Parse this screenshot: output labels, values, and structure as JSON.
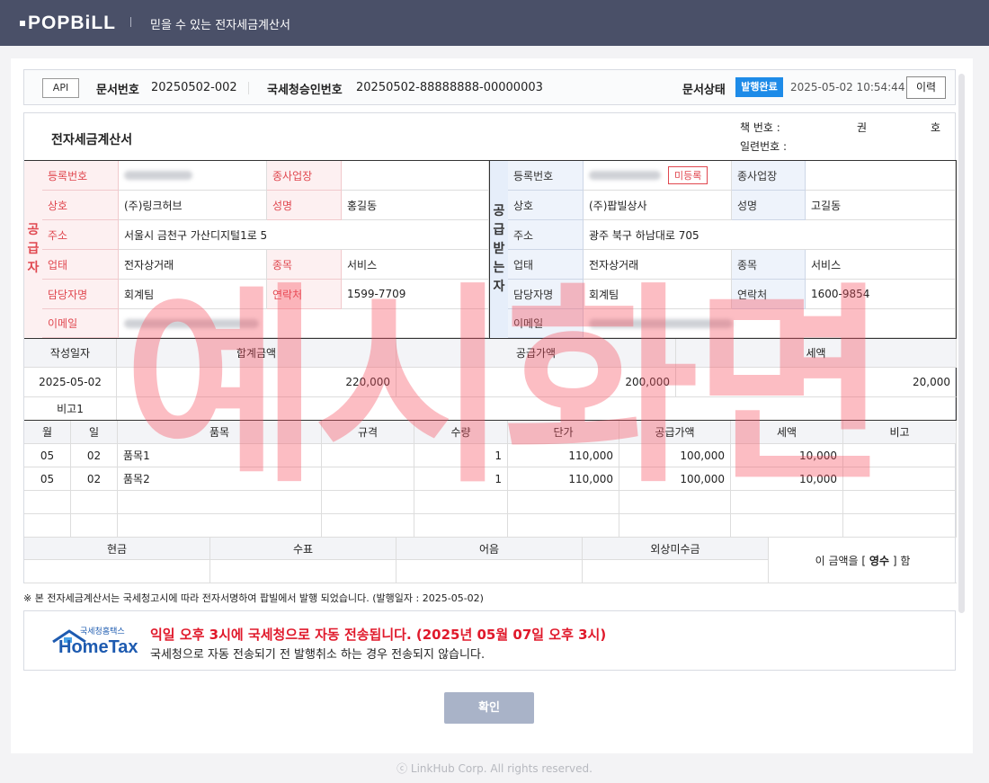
{
  "header": {
    "logo": "POPBiLL",
    "slogan": "믿을 수 있는 전자세금계산서"
  },
  "docbar": {
    "api_label": "API",
    "doc_no_label": "문서번호",
    "doc_no": "20250502-002",
    "nts_no_label": "국세청승인번호",
    "nts_no": "20250502-88888888-00000003",
    "status_label": "문서상태",
    "status": "발행완료",
    "datetime": "2025-05-02 10:54:44",
    "history_btn": "이력"
  },
  "invoice": {
    "title": "전자세금계산서",
    "book_label": "책 번호 :",
    "book_unit1": "권",
    "book_unit2": "호",
    "serial_label": "일련번호 :",
    "supplier": {
      "side_label": [
        "공",
        "급",
        "자"
      ],
      "reg_label": "등록번호",
      "branch_label": "종사업장",
      "name_label": "상호",
      "name": "(주)링크허브",
      "ceo_label": "성명",
      "ceo": "홍길동",
      "addr_label": "주소",
      "addr": "서울시 금천구 가산디지털1로 5",
      "biz_label": "업태",
      "biz": "전자상거래",
      "item_label": "종목",
      "item": "서비스",
      "contact_label": "담당자명",
      "contact": "회계팀",
      "tel_label": "연락처",
      "tel": "1599-7709",
      "email_label": "이메일"
    },
    "buyer": {
      "side_label": [
        "공",
        "급",
        "받",
        "는",
        "자"
      ],
      "reg_label": "등록번호",
      "unreg_badge": "미등록",
      "branch_label": "종사업장",
      "name_label": "상호",
      "name": "(주)팝빌상사",
      "ceo_label": "성명",
      "ceo": "고길동",
      "addr_label": "주소",
      "addr": "광주 북구 하남대로 705",
      "biz_label": "업태",
      "biz": "전자상거래",
      "item_label": "종목",
      "item": "서비스",
      "contact_label": "담당자명",
      "contact": "회계팀",
      "tel_label": "연락처",
      "tel": "1600-9854",
      "email_label": "이메일"
    },
    "summary": {
      "date_label": "작성일자",
      "total_label": "합계금액",
      "supply_label": "공급가액",
      "tax_label": "세액",
      "date": "2025-05-02",
      "total": "220,000",
      "supply": "200,000",
      "tax": "20,000",
      "remark_label": "비고1"
    },
    "items_header": [
      "월",
      "일",
      "품목",
      "규격",
      "수량",
      "단가",
      "공급가액",
      "세액",
      "비고"
    ],
    "items": [
      {
        "month": "05",
        "day": "02",
        "name": "품목1",
        "spec": "",
        "qty": "1",
        "price": "110,000",
        "supply": "100,000",
        "tax": "10,000",
        "note": ""
      },
      {
        "month": "05",
        "day": "02",
        "name": "품목2",
        "spec": "",
        "qty": "1",
        "price": "110,000",
        "supply": "100,000",
        "tax": "10,000",
        "note": ""
      }
    ],
    "payment": {
      "cash": "현금",
      "check": "수표",
      "note": "어음",
      "credit": "외상미수금",
      "receipt_pre": "이 금액을 [",
      "receipt_word": "영수",
      "receipt_post": "] 함"
    }
  },
  "footnote": "※ 본 전자세금계산서는 국세청고시에 따라 전자서명하여 팝빌에서 발행 되었습니다. (발행일자 : 2025-05-02)",
  "hometax": {
    "logo_top": "국세청홈택스",
    "logo": "HomeTax",
    "headline": "익일 오후 3시에 국세청으로 자동 전송됩니다. (2025년 05월 07일 오후 3시)",
    "sub": "국세청으로 자동 전송되기 전 발행취소 하는 경우 전송되지 않습니다."
  },
  "confirm_btn": "확인",
  "copyright": "ⓒ LinkHub Corp. All rights reserved.",
  "watermark": "예시화면",
  "colors": {
    "topbar": "#4a5068",
    "badge": "#1d8be8",
    "red": "#e0474f",
    "watermark": "#f85260"
  }
}
